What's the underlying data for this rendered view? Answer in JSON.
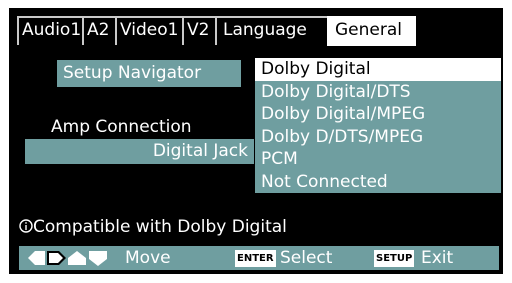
{
  "tabs": [
    {
      "label": "Audio1",
      "active": false
    },
    {
      "label": "A2",
      "active": false
    },
    {
      "label": "Video1",
      "active": false
    },
    {
      "label": "V2",
      "active": false
    },
    {
      "label": "Language",
      "active": false
    },
    {
      "label": "General",
      "active": true
    }
  ],
  "left_panel": {
    "setup_navigator": "Setup Navigator",
    "amp_connection": "Amp Connection",
    "digital_jack": "Digital Jack"
  },
  "options": [
    {
      "label": "Dolby Digital",
      "selected": true
    },
    {
      "label": "Dolby Digital/DTS",
      "selected": false
    },
    {
      "label": "Dolby Digital/MPEG",
      "selected": false
    },
    {
      "label": "Dolby D/DTS/MPEG",
      "selected": false
    },
    {
      "label": "PCM",
      "selected": false
    },
    {
      "label": "Not Connected",
      "selected": false
    }
  ],
  "info": {
    "icon": "info-icon",
    "text": "Compatible with Dolby Digital"
  },
  "bottom_bar": {
    "arrow_icons": [
      "left-arrow-icon",
      "right-arrow-icon",
      "up-arrow-icon",
      "down-arrow-icon"
    ],
    "move_label": "Move",
    "enter_key": "ENTER",
    "select_label": "Select",
    "setup_key": "SETUP",
    "exit_label": "Exit"
  },
  "colors": {
    "background": "#000000",
    "accent": "#6f9ea0",
    "highlight": "#ffffff",
    "text": "#ffffff"
  }
}
